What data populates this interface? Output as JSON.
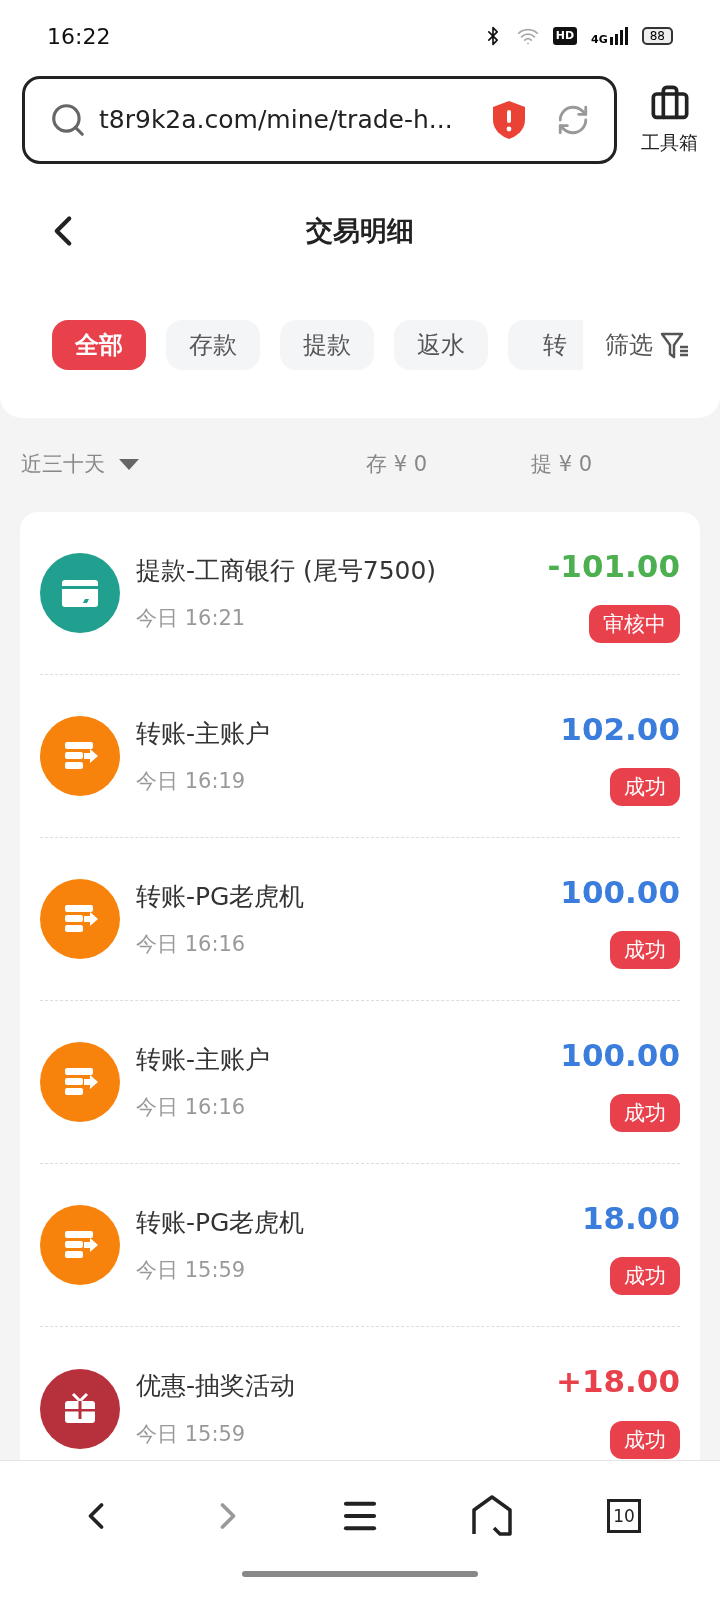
{
  "status_bar": {
    "time": "16:22",
    "hd": "HD",
    "network": "4G",
    "battery": "88"
  },
  "browser": {
    "url": "t8r9k2a.com/mine/trade-h...",
    "toolbox": "工具箱"
  },
  "header": {
    "title": "交易明细"
  },
  "tabs": [
    {
      "label": "全部",
      "selected": true
    },
    {
      "label": "存款",
      "selected": false
    },
    {
      "label": "提款",
      "selected": false
    },
    {
      "label": "返水",
      "selected": false
    },
    {
      "label": "转",
      "selected": false
    }
  ],
  "filter": "筛选",
  "summary": {
    "period": "近三十天",
    "deposit": "存 ¥ 0",
    "withdraw": "提 ¥ 0"
  },
  "transactions": [
    {
      "kind": "withdraw",
      "title": "提款-工商银行 (尾号7500)",
      "time": "今日 16:21",
      "amount": "-101.00",
      "color": "#4caf50",
      "status": "审核中"
    },
    {
      "kind": "transfer",
      "title": "转账-主账户",
      "time": "今日 16:19",
      "amount": "102.00",
      "color": "#3b7ddd",
      "status": "成功"
    },
    {
      "kind": "transfer",
      "title": "转账-PG老虎机",
      "time": "今日 16:16",
      "amount": "100.00",
      "color": "#3b7ddd",
      "status": "成功"
    },
    {
      "kind": "transfer",
      "title": "转账-主账户",
      "time": "今日 16:16",
      "amount": "100.00",
      "color": "#3b7ddd",
      "status": "成功"
    },
    {
      "kind": "transfer",
      "title": "转账-PG老虎机",
      "time": "今日 15:59",
      "amount": "18.00",
      "color": "#3b7ddd",
      "status": "成功"
    },
    {
      "kind": "promo",
      "title": "优惠-抽奖活动",
      "time": "今日 15:59",
      "amount": "+18.00",
      "color": "#e8414b",
      "status": "成功"
    }
  ],
  "nav": [
    {
      "kind": "back",
      "disabled": false
    },
    {
      "kind": "forward",
      "disabled": true
    },
    {
      "kind": "menu",
      "disabled": false
    },
    {
      "kind": "home",
      "disabled": false
    },
    {
      "kind": "tabs",
      "disabled": false,
      "count": "10"
    }
  ]
}
